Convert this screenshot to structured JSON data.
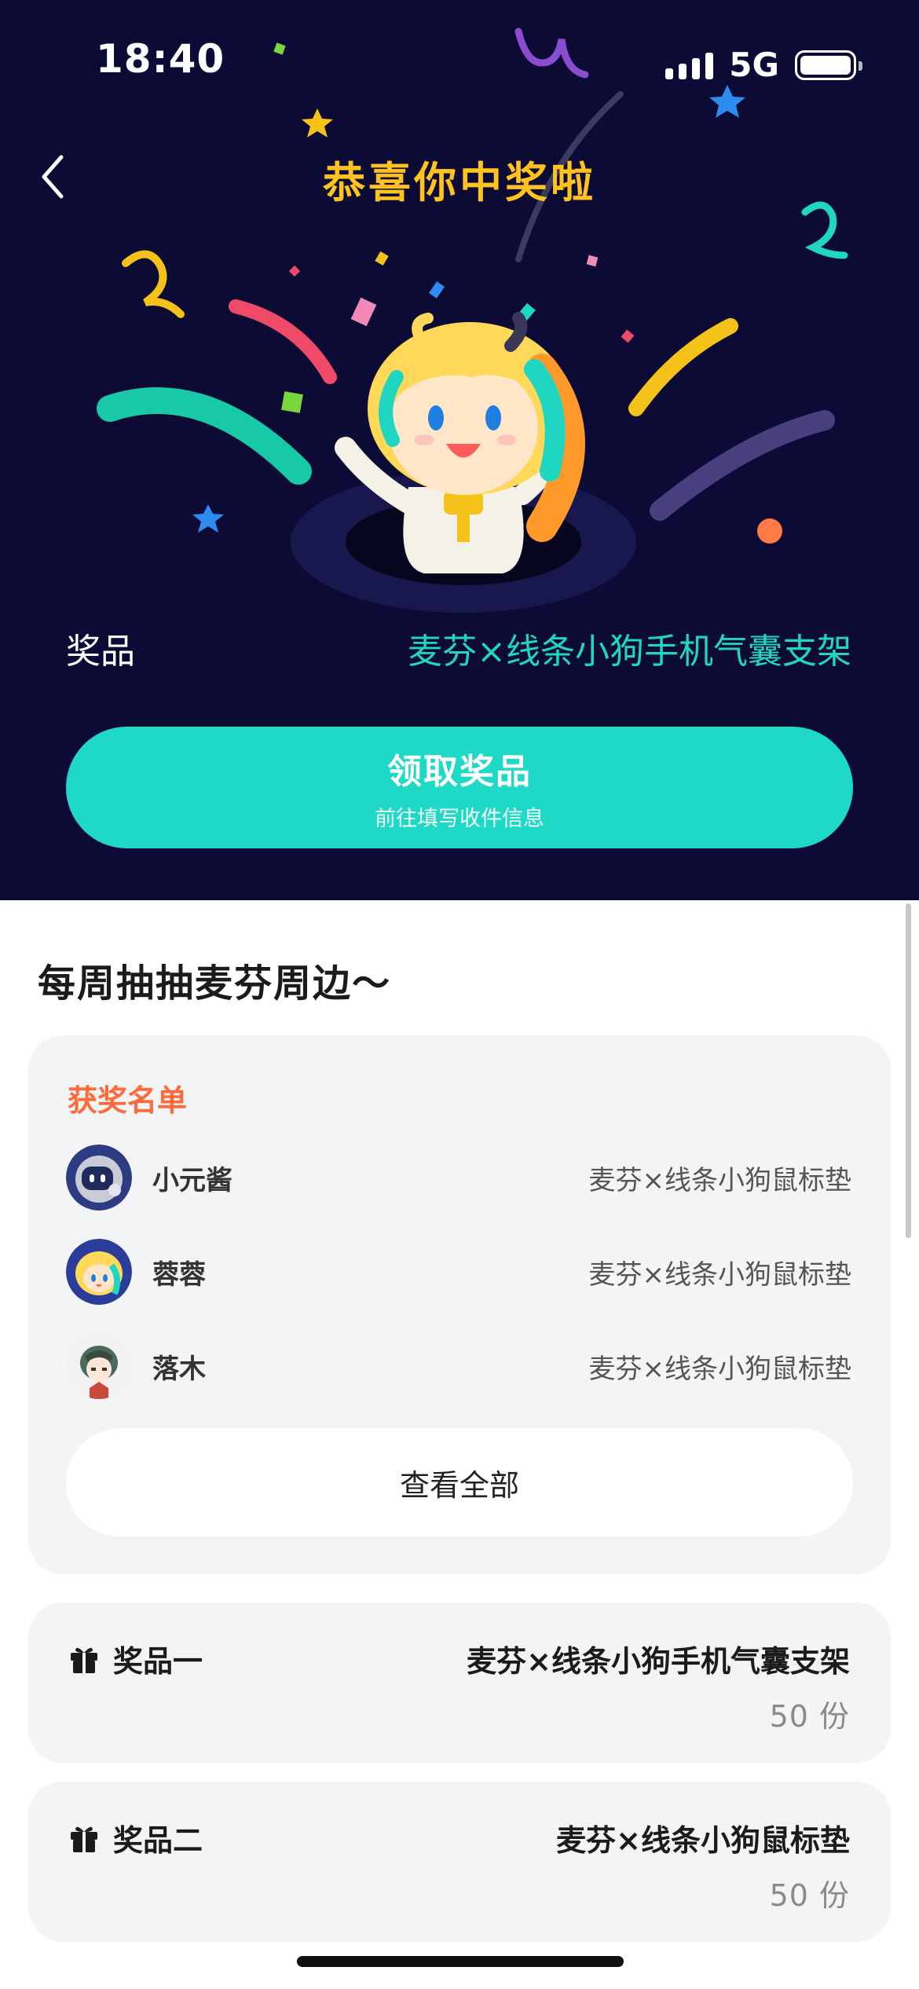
{
  "status_bar": {
    "time": "18:40",
    "network": "5G"
  },
  "hero": {
    "title": "恭喜你中奖啦",
    "prize_label": "奖品",
    "prize_value": "麦芬×线条小狗手机气囊支架",
    "claim_button": {
      "label": "领取奖品",
      "sublabel": "前往填写收件信息"
    }
  },
  "section": {
    "title": "每周抽抽麦芬周边～"
  },
  "winners": {
    "title": "获奖名单",
    "rows": [
      {
        "name": "小元酱",
        "prize": "麦芬×线条小狗鼠标垫"
      },
      {
        "name": "蓉蓉",
        "prize": "麦芬×线条小狗鼠标垫"
      },
      {
        "name": "落木",
        "prize": "麦芬×线条小狗鼠标垫"
      }
    ],
    "view_all": "查看全部"
  },
  "prizes": [
    {
      "name": "奖品一",
      "item": "麦芬×线条小狗手机气囊支架",
      "quantity": "50 份"
    },
    {
      "name": "奖品二",
      "item": "麦芬×线条小狗鼠标垫",
      "quantity": "50 份"
    }
  ],
  "colors": {
    "hero_bg": "#0c0b35",
    "title_yellow": "#ffc21e",
    "accent_teal": "#1dd9c6",
    "winners_title": "#ff6a3a",
    "card_bg": "#f3f4f6"
  },
  "icons": [
    "back-chevron-icon",
    "signal-icon",
    "battery-icon",
    "gift-icon"
  ]
}
